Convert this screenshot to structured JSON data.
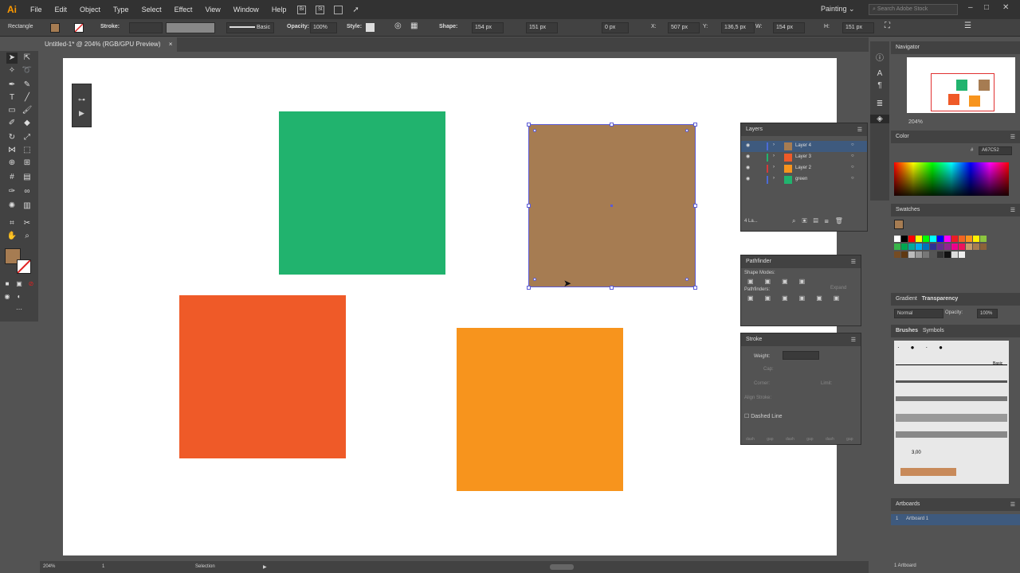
{
  "app": {
    "logo": "Ai"
  },
  "menu": [
    "File",
    "Edit",
    "Object",
    "Type",
    "Select",
    "Effect",
    "View",
    "Window",
    "Help"
  ],
  "menu_icons": [
    "Br",
    "St"
  ],
  "workspace": "Painting",
  "search_placeholder": "Search Adobe Stock",
  "control": {
    "tool_name": "Rectangle",
    "stroke_label": "Stroke:",
    "brush_label": "Basic",
    "opacity_label": "Opacity:",
    "opacity_value": "100%",
    "style_label": "Style:",
    "shape_label": "Shape:",
    "shape_w": "154 px",
    "shape_h": "151 px",
    "corner": "0 px",
    "x_label": "X:",
    "x": "507 px",
    "y_label": "Y:",
    "y": "136,5 px",
    "w_label": "W:",
    "w": "154 px",
    "h_label": "H:",
    "h": "151 px",
    "fill_color": "#A67C52"
  },
  "doc_tab": {
    "title": "Untitled-1* @ 204% (RGB/GPU Preview)",
    "close": "×"
  },
  "shapes": {
    "green": "#21B36E",
    "brown": "#A67C52",
    "red": "#EF5A28",
    "orange": "#F7941D"
  },
  "navigator": {
    "title": "Navigator",
    "zoom": "204%"
  },
  "color": {
    "title": "Color",
    "hex_label": "#",
    "hex": "A67C52"
  },
  "swatches": {
    "title": "Swatches"
  },
  "gradient": {
    "tab1": "Gradient",
    "tab2": "Transparency",
    "blend": "Normal",
    "opacity_label": "Opacity:",
    "opacity": "100%"
  },
  "brushes": {
    "tab1": "Brushes",
    "tab2": "Symbols",
    "basic": "Basic",
    "size": "3,00"
  },
  "artboards": {
    "title": "Artboards",
    "num": "1",
    "name": "Artboard 1",
    "count": "1 Artboard"
  },
  "layers": {
    "title": "Layers",
    "items": [
      {
        "name": "Layer 4",
        "color": "#A67C52",
        "bar": "#4b6bd6"
      },
      {
        "name": "Layer 3",
        "color": "#EF5A28",
        "bar": "#21B36E"
      },
      {
        "name": "Layer 2",
        "color": "#F7941D",
        "bar": "#d63a3a"
      },
      {
        "name": "green",
        "color": "#21B36E",
        "bar": "#4b6bd6"
      }
    ],
    "footer": "4 La..."
  },
  "pathfinder": {
    "title": "Pathfinder",
    "shape_modes": "Shape Modes:",
    "expand": "Expand",
    "pathfinders": "Pathfinders:"
  },
  "stroke": {
    "title": "Stroke",
    "weight": "Weight:",
    "cap": "Cap:",
    "corner": "Corner:",
    "limit": "Limit:",
    "align": "Align Stroke:",
    "dashed": "Dashed Line",
    "dash_labels": [
      "dash",
      "gap",
      "dash",
      "gap",
      "dash",
      "gap"
    ]
  },
  "status": {
    "zoom": "204%",
    "page": "1",
    "mode": "Selection"
  }
}
